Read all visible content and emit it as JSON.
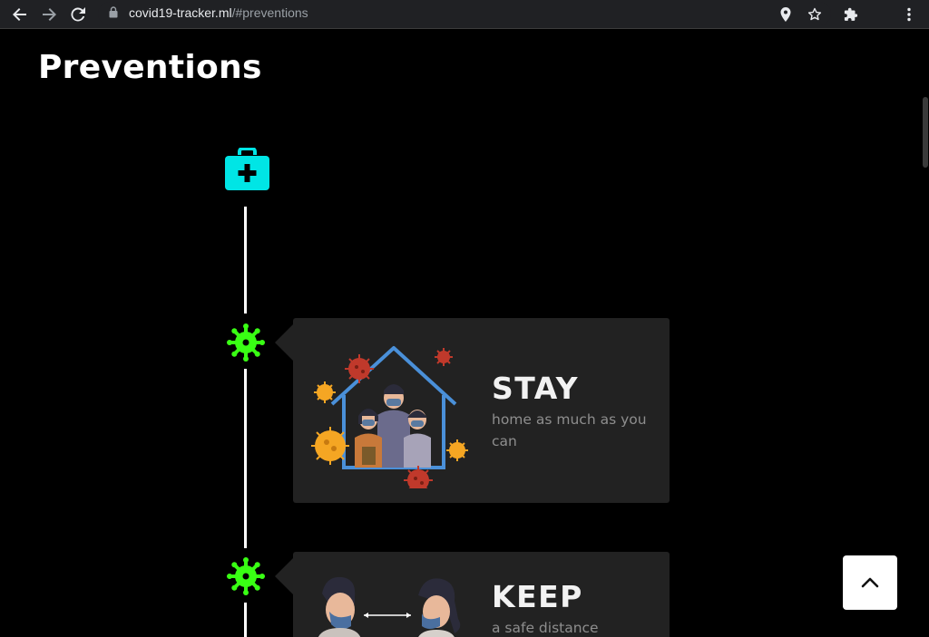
{
  "browser": {
    "url_host": "covid19-tracker.ml",
    "url_path": "/#preventions"
  },
  "page": {
    "title": "Preventions"
  },
  "timeline": {
    "items": [
      {
        "heading": "STAY",
        "text": "home as much as you can"
      },
      {
        "heading": "KEEP",
        "text": "a safe distance"
      }
    ]
  },
  "colors": {
    "accent_cyan": "#00e5e5",
    "virus_green": "#39ff14",
    "card_bg": "#222222"
  },
  "icons": {
    "first_aid": "first-aid-kit-icon",
    "virus": "virus-icon",
    "back_to_top": "chevron-up-icon"
  }
}
